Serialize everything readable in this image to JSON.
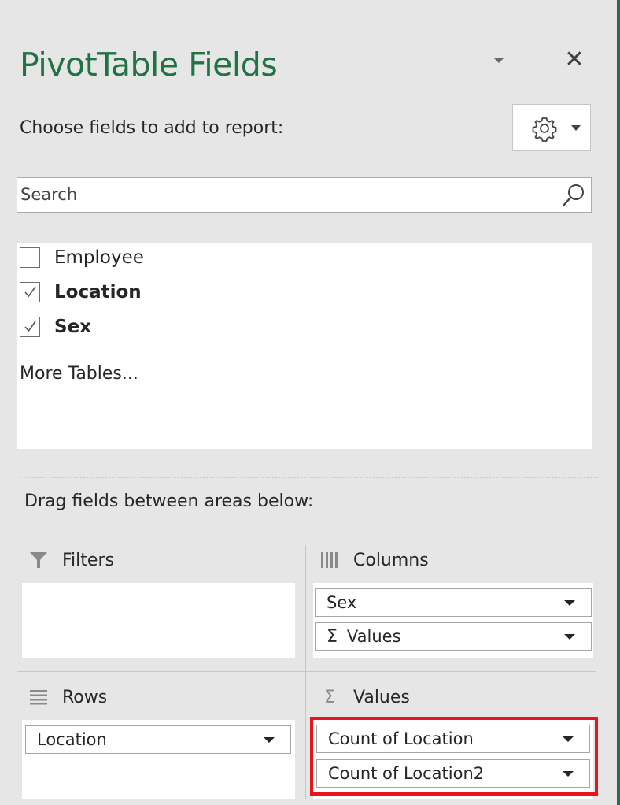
{
  "pane": {
    "title": "PivotTable Fields",
    "close_glyph": "✕",
    "title_dropdown_icon": "chevron-down-icon",
    "tools_icon": "gear-icon",
    "accent_color": "#217346",
    "highlight_color": "#e8141b"
  },
  "choose_label": "Choose fields to add to report:",
  "search": {
    "placeholder": "Search",
    "value": ""
  },
  "fields": [
    {
      "label": "Employee",
      "checked": false
    },
    {
      "label": "Location",
      "checked": true
    },
    {
      "label": "Sex",
      "checked": true
    }
  ],
  "more_tables": "More Tables...",
  "drag_label": "Drag fields between areas below:",
  "areas": {
    "filters": {
      "label": "Filters",
      "items": []
    },
    "columns": {
      "label": "Columns",
      "items": [
        "Sex",
        "Values"
      ]
    },
    "rows": {
      "label": "Rows",
      "items": [
        "Location"
      ]
    },
    "values": {
      "label": "Values",
      "items": [
        "Count of Location",
        "Count of Location2"
      ]
    }
  }
}
